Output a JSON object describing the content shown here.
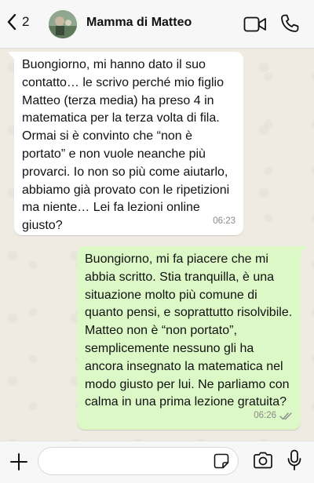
{
  "header": {
    "back_count": "2",
    "contact_name": "Mamma di Matteo"
  },
  "messages": [
    {
      "direction": "incoming",
      "text": "Buongiorno, mi hanno dato il suo contatto… le scrivo perché mio figlio Matteo (terza media) ha preso 4 in matematica per la terza volta di fila. Ormai si è convinto che “non è portato” e non vuole neanche più provarci. Io non so più come aiutarlo, abbiamo già provato con le ripetizioni ma niente… Lei fa lezioni online giusto?",
      "time": "06:23"
    },
    {
      "direction": "outgoing",
      "text": "Buongiorno, mi fa piacere che mi abbia scritto. Stia tranquilla, è una situazione molto più comune di quanto pensi, e soprattutto risolvibile. Matteo non è “non portato”, semplicemente nessuno gli ha ancora insegnato la matematica nel modo giusto per lui. Ne parliamo con calma in una prima lezione gratuita?",
      "time": "06:26",
      "status": "read-double-check"
    }
  ],
  "composer": {
    "value": "",
    "placeholder": ""
  },
  "icons": {
    "back": "chevron-left-icon",
    "video": "video-call-icon",
    "phone": "phone-icon",
    "plus": "plus-icon",
    "sticker": "sticker-icon",
    "camera": "camera-icon",
    "mic": "microphone-icon"
  },
  "colors": {
    "incoming_bubble": "#ffffff",
    "outgoing_bubble": "#dbf8c6",
    "chat_background": "#efeae2",
    "header_background": "#f7f7f7"
  }
}
